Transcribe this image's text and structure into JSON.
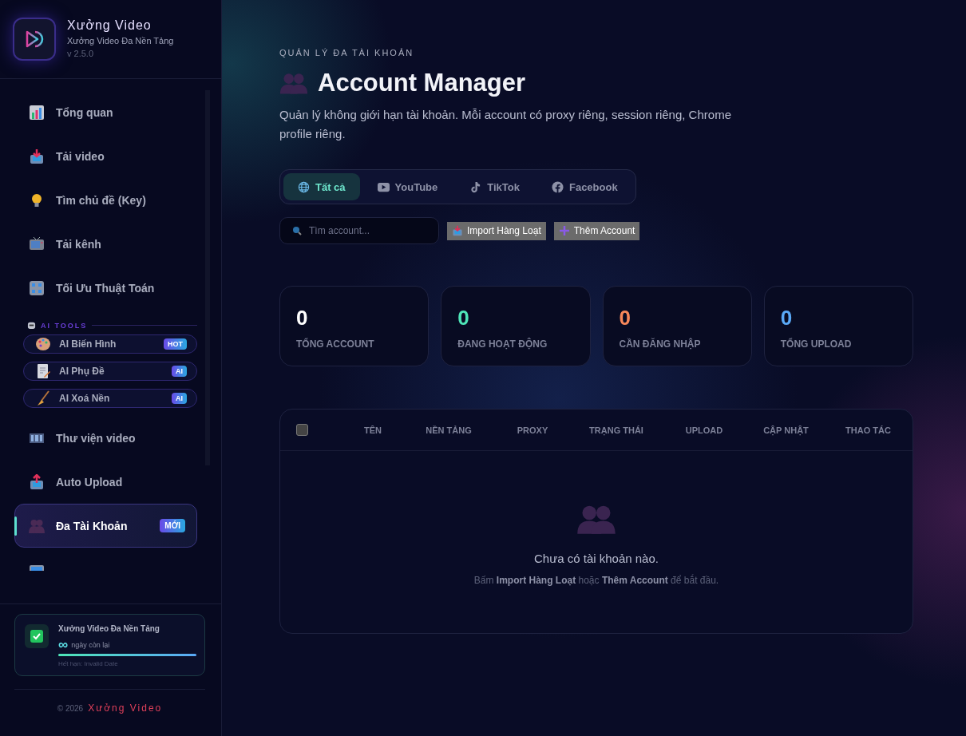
{
  "brand": {
    "name": "Xưởng Video",
    "subtitle": "Xưởng Video Đa Nền Tảng",
    "version": "v 2.5.0"
  },
  "sidebar": {
    "items": [
      {
        "kind": "item",
        "label": "Tổng quan",
        "selected": false
      },
      {
        "kind": "item",
        "label": "Tải video",
        "selected": false
      },
      {
        "kind": "item",
        "label": "Tìm chủ đề (Key)",
        "selected": false
      },
      {
        "kind": "item",
        "label": "Tải kênh",
        "selected": false
      },
      {
        "kind": "item",
        "label": "Tối Ưu Thuật Toán",
        "selected": false
      },
      {
        "kind": "section",
        "label": "AI TOOLS"
      },
      {
        "kind": "ai",
        "label": "AI Biến Hình",
        "badge": "HOT",
        "selected": false
      },
      {
        "kind": "ai",
        "label": "AI Phụ Đề",
        "badge": "AI",
        "selected": false
      },
      {
        "kind": "ai",
        "label": "AI Xoá Nền",
        "badge": "AI",
        "selected": false
      },
      {
        "kind": "item",
        "label": "Thư viện video",
        "selected": false
      },
      {
        "kind": "item",
        "label": "Auto Upload",
        "selected": false
      },
      {
        "kind": "item",
        "label": "Đa Tài Khoản",
        "badge": "MỚI",
        "selected": true
      },
      {
        "kind": "partial"
      }
    ]
  },
  "license": {
    "title": "Xưởng Video Đa Nền Tảng",
    "days": "∞",
    "days_label": "ngày còn lại",
    "level": 1,
    "expiry": "Hết hạn: Invalid Date"
  },
  "footer": {
    "copyright": "© 2026",
    "brand": "Xưởng Video"
  },
  "header": {
    "eyebrow": "QUẢN LÝ ĐA TÀI KHOẢN",
    "title": "Account Manager",
    "description": "Quản lý không giới hạn tài khoản. Mỗi account có proxy riêng, session riêng, Chrome profile riêng."
  },
  "filter_tabs": [
    {
      "label": "Tất cả",
      "selected": true
    },
    {
      "label": "YouTube",
      "selected": false
    },
    {
      "label": "TikTok",
      "selected": false
    },
    {
      "label": "Facebook",
      "selected": false
    }
  ],
  "search": {
    "placeholder": "Tìm account..."
  },
  "buttons": [
    "Import Hàng Loạt",
    "Thêm Account"
  ],
  "stats": [
    {
      "value": "0",
      "label": "TỔNG ACCOUNT",
      "color": "#ffffff"
    },
    {
      "value": "0",
      "label": "ĐANG HOẠT ĐỘNG",
      "color": "#4ee6b8"
    },
    {
      "value": "0",
      "label": "CẦN ĐĂNG NHẬP",
      "color": "#f7875a"
    },
    {
      "value": "0",
      "label": "TỔNG UPLOAD",
      "color": "#5aa9f7"
    }
  ],
  "table": {
    "select_all": {
      "checked": false
    },
    "columns": [
      "TÊN",
      "NỀN TẢNG",
      "PROXY",
      "TRẠNG THÁI",
      "UPLOAD",
      "CẬP NHẬT",
      "THAO TÁC"
    ],
    "empty": {
      "title": "Chưa có tài khoản nào.",
      "hint": "Bấm **Import Hàng Loạt** hoặc **Thêm Account** để bắt đầu."
    }
  }
}
